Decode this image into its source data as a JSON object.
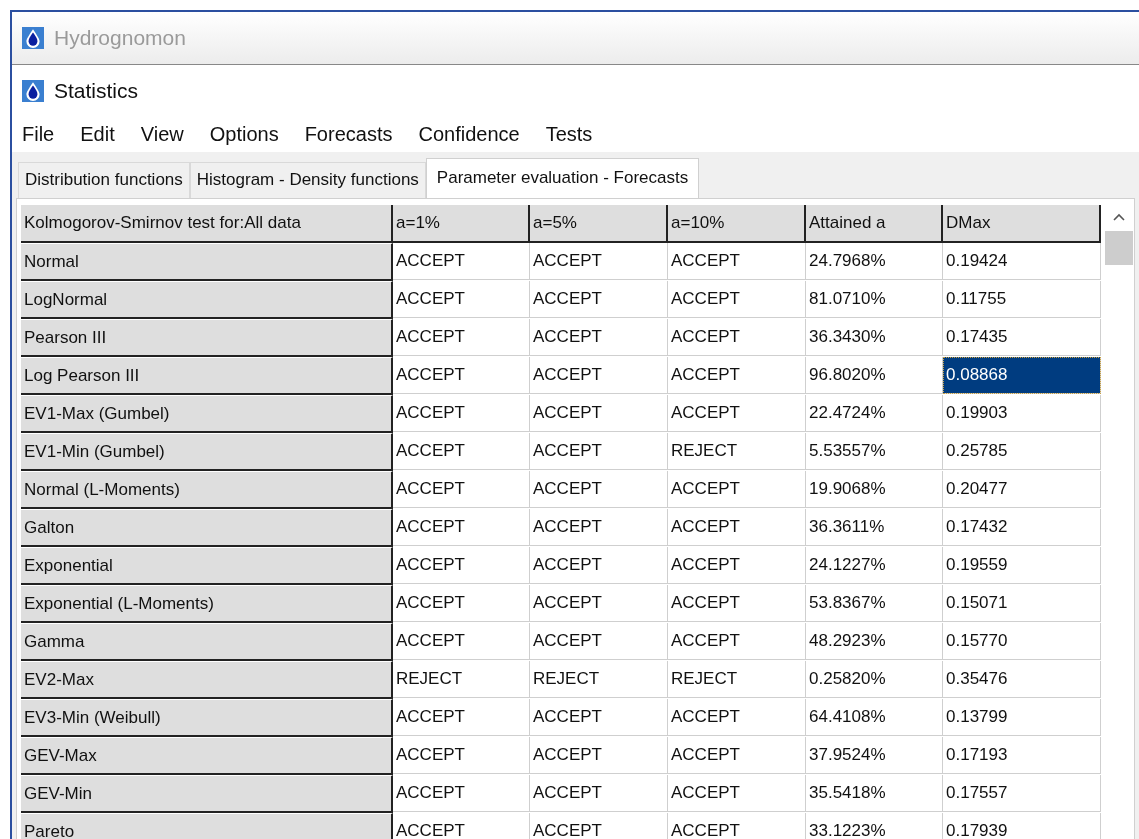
{
  "window": {
    "title": "Hydrognomon"
  },
  "subwindow": {
    "title": "Statistics"
  },
  "menu": [
    "File",
    "Edit",
    "View",
    "Options",
    "Forecasts",
    "Confidence",
    "Tests"
  ],
  "tabs": [
    {
      "label": "Distribution functions",
      "selected": false
    },
    {
      "label": "Histogram - Density functions",
      "selected": false
    },
    {
      "label": "Parameter evaluation - Forecasts",
      "selected": true
    }
  ],
  "table": {
    "row_header_title": "Kolmogorov-Smirnov test for:All data",
    "columns": [
      "a=1%",
      "a=5%",
      "a=10%",
      "Attained a",
      "DMax"
    ],
    "rows": [
      {
        "name": "Normal",
        "cells": [
          {
            "text": "ACCEPT",
            "selected": false
          },
          {
            "text": "ACCEPT",
            "selected": false
          },
          {
            "text": "ACCEPT",
            "selected": false
          },
          {
            "text": "24.7968%",
            "selected": false
          },
          {
            "text": "0.19424",
            "selected": false
          }
        ]
      },
      {
        "name": "LogNormal",
        "cells": [
          {
            "text": "ACCEPT",
            "selected": false
          },
          {
            "text": "ACCEPT",
            "selected": false
          },
          {
            "text": "ACCEPT",
            "selected": false
          },
          {
            "text": "81.0710%",
            "selected": false
          },
          {
            "text": "0.11755",
            "selected": false
          }
        ]
      },
      {
        "name": "Pearson III",
        "cells": [
          {
            "text": "ACCEPT",
            "selected": false
          },
          {
            "text": "ACCEPT",
            "selected": false
          },
          {
            "text": "ACCEPT",
            "selected": false
          },
          {
            "text": "36.3430%",
            "selected": false
          },
          {
            "text": "0.17435",
            "selected": false
          }
        ]
      },
      {
        "name": "Log Pearson III",
        "cells": [
          {
            "text": "ACCEPT",
            "selected": false
          },
          {
            "text": "ACCEPT",
            "selected": false
          },
          {
            "text": "ACCEPT",
            "selected": false
          },
          {
            "text": "96.8020%",
            "selected": false
          },
          {
            "text": "0.08868",
            "selected": true
          }
        ]
      },
      {
        "name": "EV1-Max (Gumbel)",
        "cells": [
          {
            "text": "ACCEPT",
            "selected": false
          },
          {
            "text": "ACCEPT",
            "selected": false
          },
          {
            "text": "ACCEPT",
            "selected": false
          },
          {
            "text": "22.4724%",
            "selected": false
          },
          {
            "text": "0.19903",
            "selected": false
          }
        ]
      },
      {
        "name": "EV1-Min (Gumbel)",
        "cells": [
          {
            "text": "ACCEPT",
            "selected": false
          },
          {
            "text": "ACCEPT",
            "selected": false
          },
          {
            "text": "REJECT",
            "selected": false
          },
          {
            "text": "5.53557%",
            "selected": false
          },
          {
            "text": "0.25785",
            "selected": false
          }
        ]
      },
      {
        "name": "Normal (L-Moments)",
        "cells": [
          {
            "text": "ACCEPT",
            "selected": false
          },
          {
            "text": "ACCEPT",
            "selected": false
          },
          {
            "text": "ACCEPT",
            "selected": false
          },
          {
            "text": "19.9068%",
            "selected": false
          },
          {
            "text": "0.20477",
            "selected": false
          }
        ]
      },
      {
        "name": "Galton",
        "cells": [
          {
            "text": "ACCEPT",
            "selected": false
          },
          {
            "text": "ACCEPT",
            "selected": false
          },
          {
            "text": "ACCEPT",
            "selected": false
          },
          {
            "text": "36.3611%",
            "selected": false
          },
          {
            "text": "0.17432",
            "selected": false
          }
        ]
      },
      {
        "name": "Exponential",
        "cells": [
          {
            "text": "ACCEPT",
            "selected": false
          },
          {
            "text": "ACCEPT",
            "selected": false
          },
          {
            "text": "ACCEPT",
            "selected": false
          },
          {
            "text": "24.1227%",
            "selected": false
          },
          {
            "text": "0.19559",
            "selected": false
          }
        ]
      },
      {
        "name": "Exponential (L-Moments)",
        "cells": [
          {
            "text": "ACCEPT",
            "selected": false
          },
          {
            "text": "ACCEPT",
            "selected": false
          },
          {
            "text": "ACCEPT",
            "selected": false
          },
          {
            "text": "53.8367%",
            "selected": false
          },
          {
            "text": "0.15071",
            "selected": false
          }
        ]
      },
      {
        "name": "Gamma",
        "cells": [
          {
            "text": "ACCEPT",
            "selected": false
          },
          {
            "text": "ACCEPT",
            "selected": false
          },
          {
            "text": "ACCEPT",
            "selected": false
          },
          {
            "text": "48.2923%",
            "selected": false
          },
          {
            "text": "0.15770",
            "selected": false
          }
        ]
      },
      {
        "name": "EV2-Max",
        "cells": [
          {
            "text": "REJECT",
            "selected": false
          },
          {
            "text": "REJECT",
            "selected": false
          },
          {
            "text": "REJECT",
            "selected": false
          },
          {
            "text": "0.25820%",
            "selected": false
          },
          {
            "text": "0.35476",
            "selected": false
          }
        ]
      },
      {
        "name": "EV3-Min (Weibull)",
        "cells": [
          {
            "text": "ACCEPT",
            "selected": false
          },
          {
            "text": "ACCEPT",
            "selected": false
          },
          {
            "text": "ACCEPT",
            "selected": false
          },
          {
            "text": "64.4108%",
            "selected": false
          },
          {
            "text": "0.13799",
            "selected": false
          }
        ]
      },
      {
        "name": "GEV-Max",
        "cells": [
          {
            "text": "ACCEPT",
            "selected": false
          },
          {
            "text": "ACCEPT",
            "selected": false
          },
          {
            "text": "ACCEPT",
            "selected": false
          },
          {
            "text": "37.9524%",
            "selected": false
          },
          {
            "text": "0.17193",
            "selected": false
          }
        ]
      },
      {
        "name": "GEV-Min",
        "cells": [
          {
            "text": "ACCEPT",
            "selected": false
          },
          {
            "text": "ACCEPT",
            "selected": false
          },
          {
            "text": "ACCEPT",
            "selected": false
          },
          {
            "text": "35.5418%",
            "selected": false
          },
          {
            "text": "0.17557",
            "selected": false
          }
        ]
      },
      {
        "name": "Pareto",
        "cells": [
          {
            "text": "ACCEPT",
            "selected": false
          },
          {
            "text": "ACCEPT",
            "selected": false
          },
          {
            "text": "ACCEPT",
            "selected": false
          },
          {
            "text": "33.1223%",
            "selected": false
          },
          {
            "text": "0.17939",
            "selected": false
          }
        ]
      }
    ]
  }
}
